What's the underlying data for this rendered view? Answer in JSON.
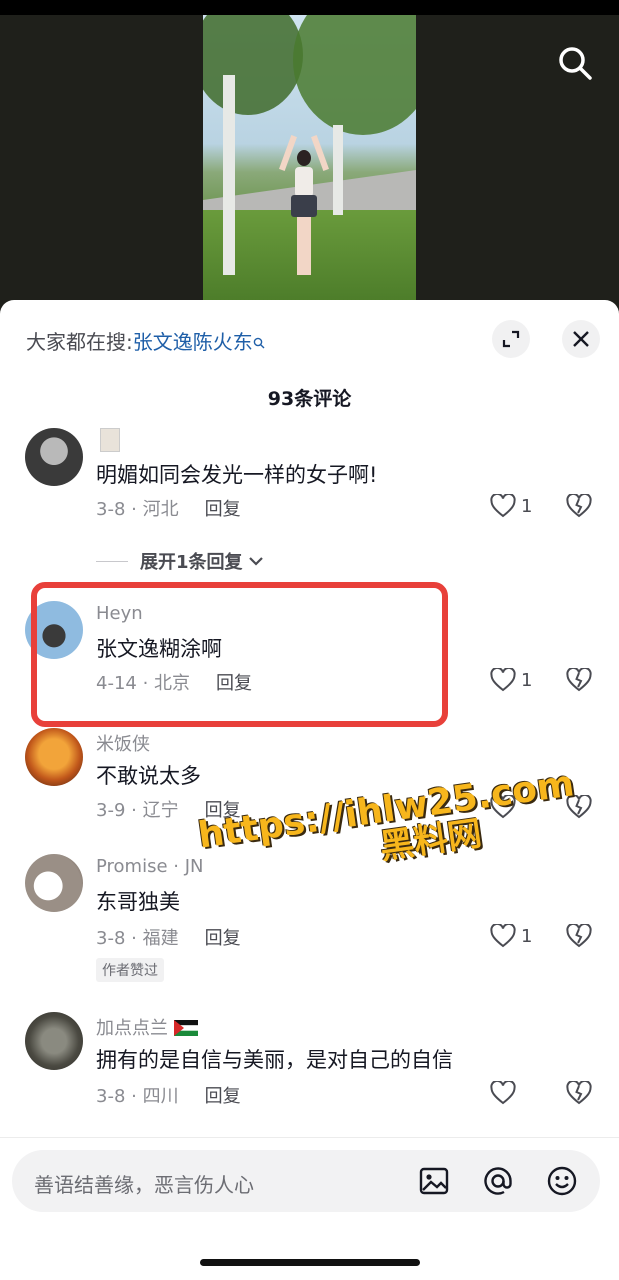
{
  "header": {
    "search_prefix": "大家都在搜:",
    "search_keyword": "张文逸陈火东"
  },
  "comment_count": "93条评论",
  "comments": [
    {
      "name": "",
      "text": "明媚如同会发光一样的女子啊!",
      "date_loc": "3-8 · 河北",
      "reply": "回复",
      "likes": "1",
      "expand": "展开1条回复"
    },
    {
      "name": "Heyn",
      "text": "张文逸糊涂啊",
      "date_loc": "4-14 · 北京",
      "reply": "回复",
      "likes": "1"
    },
    {
      "name": "米饭侠",
      "text": "不敢说太多",
      "date_loc": "3-9 · 辽宁",
      "reply": "回复",
      "likes": ""
    },
    {
      "name": "Promise · JN",
      "text": "东哥独美",
      "date_loc": "3-8 · 福建",
      "reply": "回复",
      "likes": "1",
      "badge": "作者赞过"
    },
    {
      "name": "加点点兰",
      "text": "拥有的是自信与美丽，是对自己的自信",
      "date_loc": "3-8 · 四川",
      "reply": "回复",
      "likes": ""
    }
  ],
  "watermark": {
    "url": "https://ihlw25.com",
    "site": "黑料网"
  },
  "input": {
    "placeholder": "善语结善缘，恶言伤人心"
  },
  "colors": {
    "highlight_border": "#e8403a",
    "keyword_link": "#1f5fa8",
    "watermark": "#f7b61c"
  },
  "icons": [
    "search-icon",
    "expand-icon",
    "close-icon",
    "heart-icon",
    "broken-heart-icon",
    "image-icon",
    "at-icon",
    "emoji-icon",
    "chevron-down-icon"
  ]
}
